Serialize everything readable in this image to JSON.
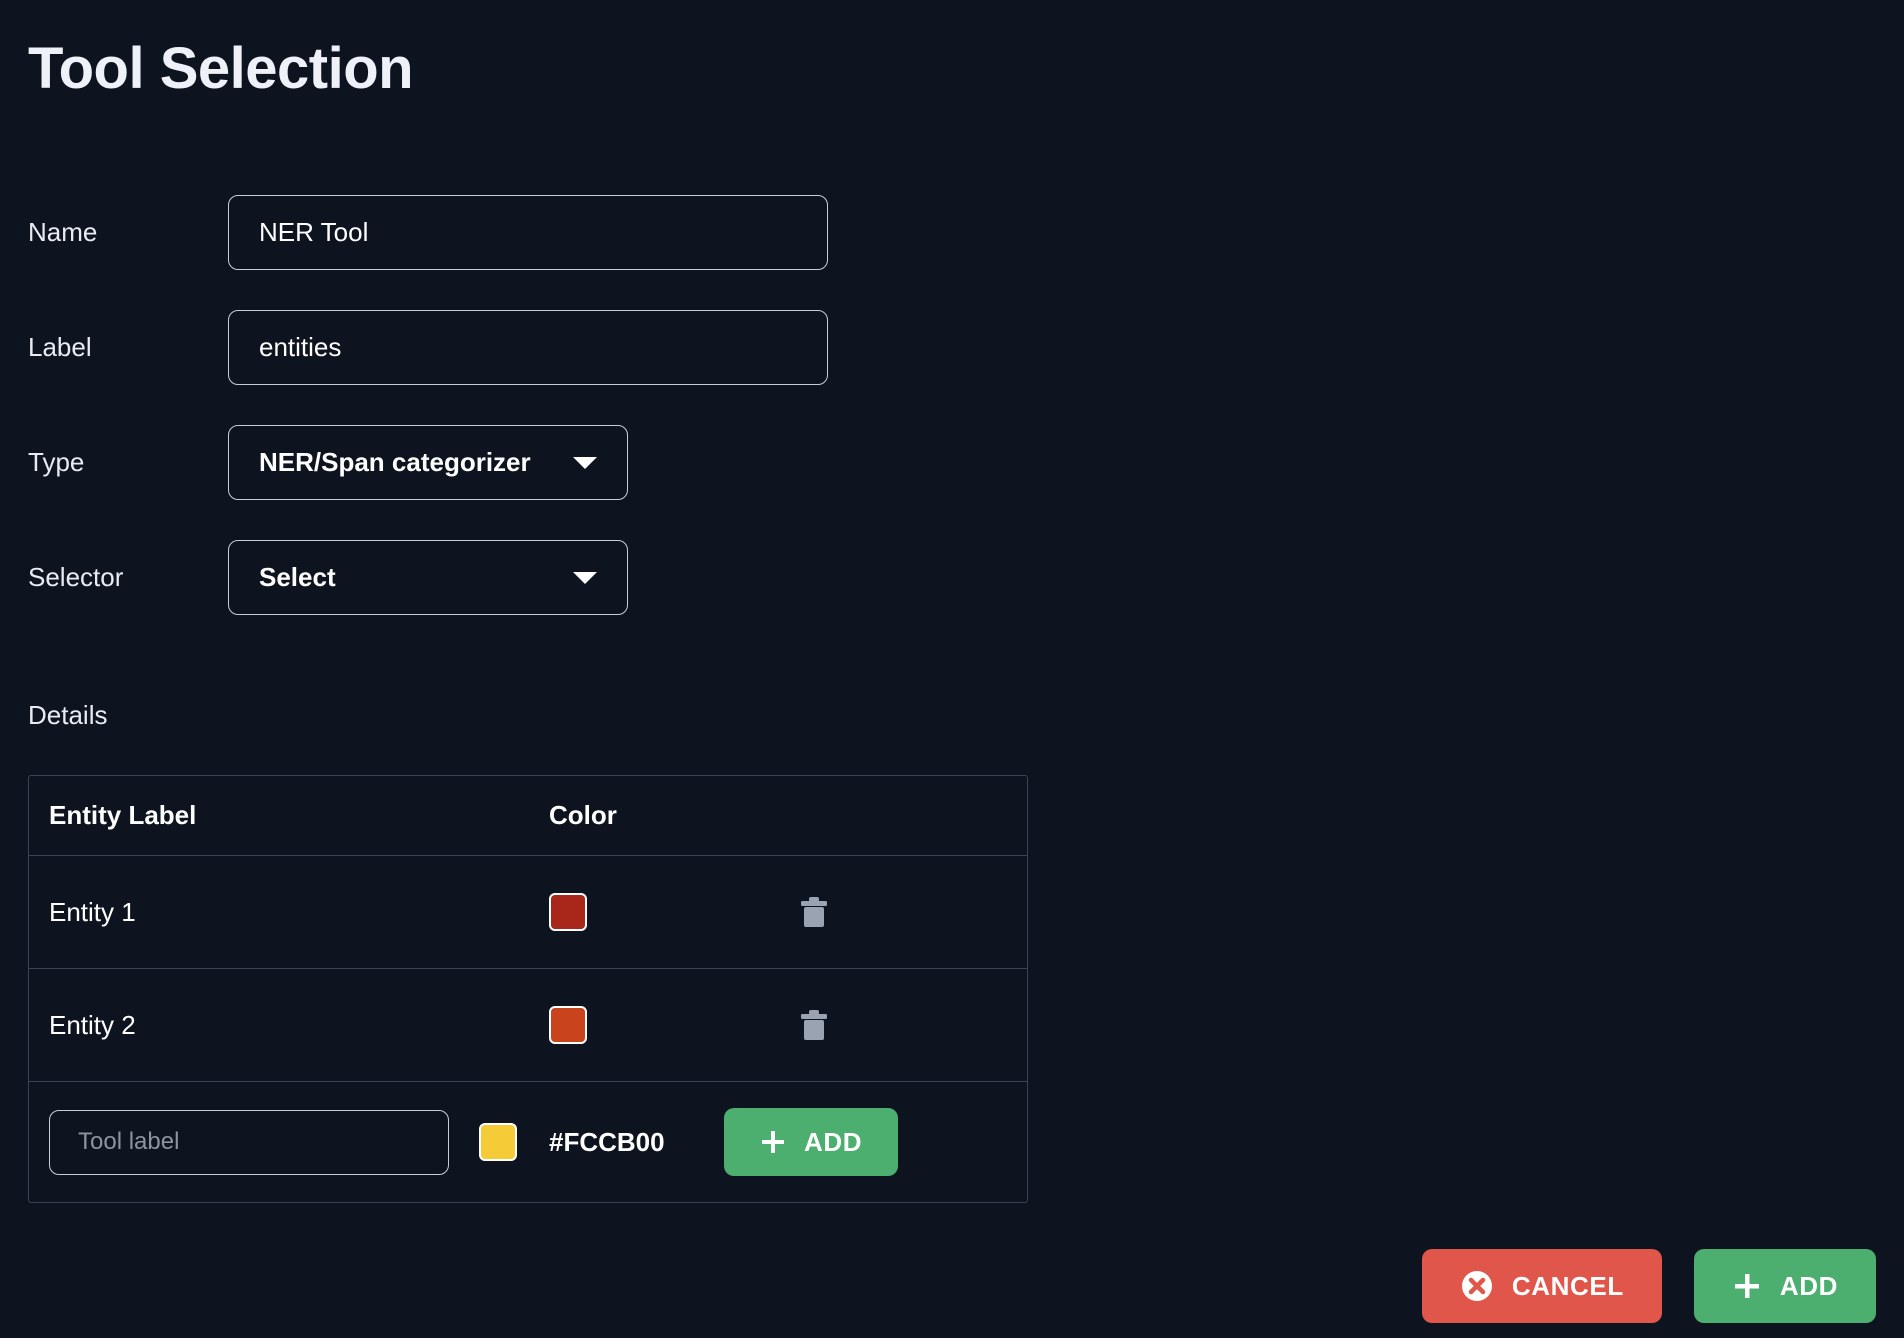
{
  "page": {
    "title": "Tool Selection",
    "background_color": "#0e1320"
  },
  "form": {
    "name": {
      "label": "Name",
      "value": "NER Tool",
      "placeholder": ""
    },
    "label_field": {
      "label": "Label",
      "value": "entities",
      "placeholder": ""
    },
    "type": {
      "label": "Type",
      "value": "NER/Span categorizer"
    },
    "selector": {
      "label": "Selector",
      "value": "Select"
    }
  },
  "details": {
    "heading": "Details",
    "columns": [
      "Entity Label",
      "Color"
    ],
    "rows": [
      {
        "label": "Entity 1",
        "color": "#a8261a",
        "delete_icon": "trash-icon"
      },
      {
        "label": "Entity 2",
        "color": "#c9431c",
        "delete_icon": "trash-icon"
      }
    ],
    "new_row": {
      "placeholder": "Tool label",
      "value": "",
      "color": "#f5cb38",
      "color_hex_text": "#FCCB00",
      "add_label": "ADD"
    }
  },
  "footer": {
    "cancel_label": "CANCEL",
    "add_label": "ADD",
    "cancel_color": "#e0564a",
    "add_color": "#4caf70"
  }
}
